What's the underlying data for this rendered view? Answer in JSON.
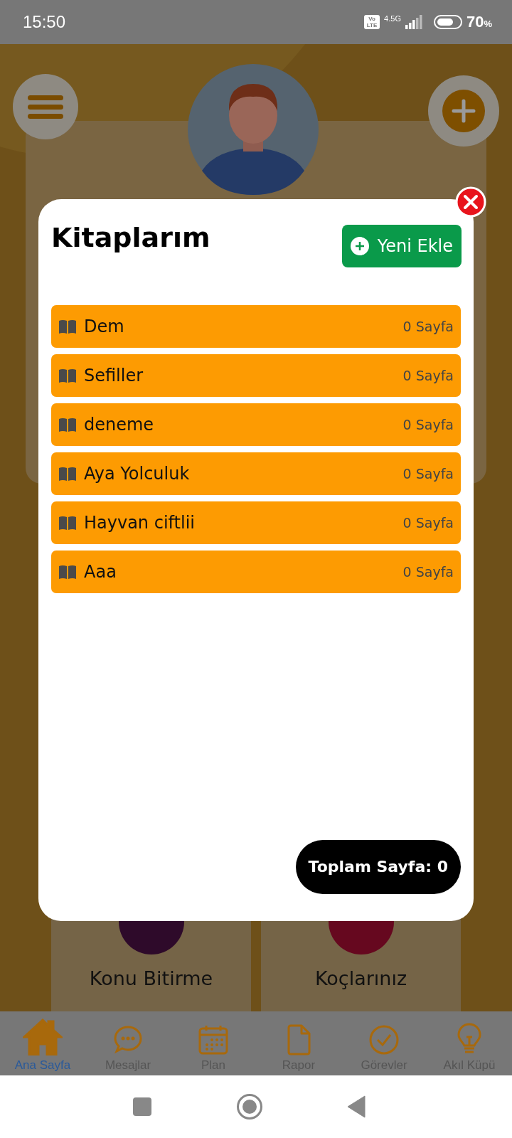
{
  "status_bar": {
    "time": "15:50",
    "volte": "Vo LTE",
    "network": "4.5G",
    "battery": "70",
    "battery_unit": "%"
  },
  "background_cards": [
    {
      "label": "Konu Bitirme",
      "color": "#2e0a2a"
    },
    {
      "label": "Koçlarınız",
      "color": "#66081f"
    }
  ],
  "modal": {
    "title": "Kitaplarım",
    "add_button": "Yeni Ekle",
    "books": [
      {
        "title": "Dem",
        "pages": "0 Sayfa"
      },
      {
        "title": "Sefiller",
        "pages": "0 Sayfa"
      },
      {
        "title": "deneme",
        "pages": "0 Sayfa"
      },
      {
        "title": "Aya Yolculuk",
        "pages": "0 Sayfa"
      },
      {
        "title": "Hayvan ciftlii",
        "pages": "0 Sayfa"
      },
      {
        "title": "Aaa",
        "pages": "0 Sayfa"
      }
    ],
    "total": "Toplam Sayfa: 0"
  },
  "tabs": [
    {
      "label": "Ana Sayfa",
      "selected": true
    },
    {
      "label": "Mesajlar",
      "selected": false
    },
    {
      "label": "Plan",
      "selected": false
    },
    {
      "label": "Rapor",
      "selected": false
    },
    {
      "label": "Görevler",
      "selected": false
    },
    {
      "label": "Akıl Küpü",
      "selected": false
    }
  ]
}
